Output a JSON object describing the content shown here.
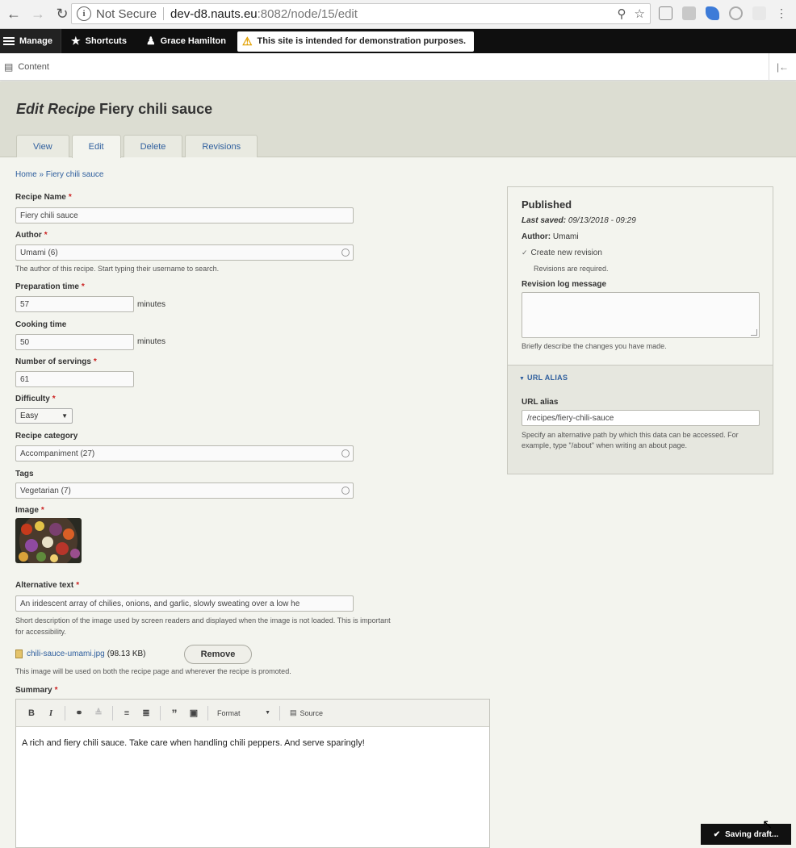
{
  "browser": {
    "secure_label": "Not Secure",
    "url_host": "dev-d8.nauts.eu",
    "url_path": ":8082/node/15/edit",
    "colors": {
      "chrome_bg": "#f2f2f2"
    }
  },
  "toolbar": {
    "manage_label": "Manage",
    "shortcuts_label": "Shortcuts",
    "user_label": "Grace Hamilton",
    "warning": "This site is intended for demonstration purposes.",
    "tray_content": "Content"
  },
  "header": {
    "title_prefix": "Edit Recipe",
    "title_name": "Fiery chili sauce",
    "tabs": [
      {
        "label": "View"
      },
      {
        "label": "Edit"
      },
      {
        "label": "Delete"
      },
      {
        "label": "Revisions"
      }
    ]
  },
  "breadcrumb": "Home » Fiery chili sauce",
  "form": {
    "recipe_name": {
      "label": "Recipe Name",
      "value": "Fiery chili sauce"
    },
    "author": {
      "label": "Author",
      "value": "Umami (6)",
      "description": "The author of this recipe. Start typing their username to search."
    },
    "prep_time": {
      "label": "Preparation time",
      "value": "57",
      "unit": "minutes"
    },
    "cook_time": {
      "label": "Cooking time",
      "value": "50",
      "unit": "minutes"
    },
    "servings": {
      "label": "Number of servings",
      "value": "61"
    },
    "difficulty": {
      "label": "Difficulty",
      "value": "Easy"
    },
    "category": {
      "label": "Recipe category",
      "value": "Accompaniment (27)"
    },
    "tags": {
      "label": "Tags",
      "value": "Vegetarian (7)"
    },
    "image": {
      "label": "Image"
    },
    "alt_text": {
      "label": "Alternative text",
      "value": "An iridescent array of chilies, onions, and garlic, slowly sweating over a low he",
      "description_line1": "Short description of the image used by screen readers and displayed when the image is not loaded. This is important",
      "description_line2": "for accessibility."
    },
    "file": {
      "name": "chili-sauce-umami.jpg",
      "size": "(98.13 KB)",
      "remove_label": "Remove",
      "description": "This image will be used on both the recipe page and wherever the recipe is promoted."
    },
    "summary": {
      "label": "Summary",
      "format_label": "Format",
      "source_label": "Source",
      "text": "A rich and fiery chili sauce. Take care when handling chili peppers. And serve sparingly!"
    }
  },
  "sidebar": {
    "status": "Published",
    "last_saved_label": "Last saved:",
    "last_saved_value": "09/13/2018 - 09:29",
    "author_label": "Author:",
    "author_value": "Umami",
    "create_revision": "Create new revision",
    "revisions_required": "Revisions are required.",
    "revision_log_label": "Revision log message",
    "revision_log_desc": "Briefly describe the changes you have made.",
    "url_alias_heading": "URL ALIAS",
    "url_alias_label": "URL alias",
    "url_alias_value": "/recipes/fiery-chili-sauce",
    "url_alias_desc": "Specify an alternative path by which this data can be accessed. For example, type \"/about\" when writing an about page."
  },
  "status": {
    "saving": "Saving draft..."
  }
}
